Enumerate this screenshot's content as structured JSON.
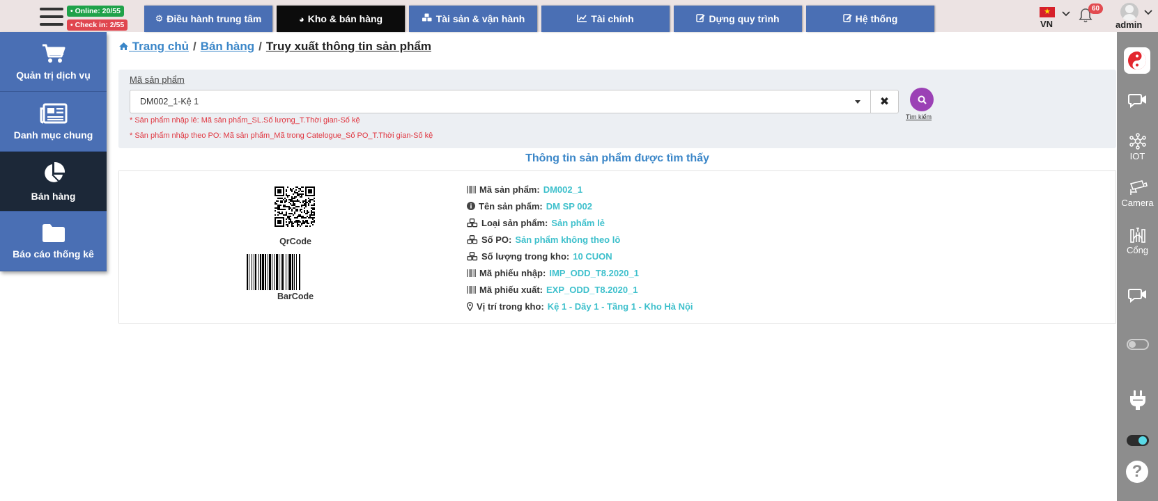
{
  "header": {
    "online_badge": "• Online: 20/55",
    "checkin_badge": "• Check in: 2/55",
    "tabs": [
      {
        "icon": "gear-icon",
        "label": "Điều hành trung tâm"
      },
      {
        "icon": "pie-chart-icon",
        "label": "Kho & bán hàng"
      },
      {
        "icon": "cubes-icon",
        "label": "Tài sản & vận hành"
      },
      {
        "icon": "line-chart-icon",
        "label": "Tài chính"
      },
      {
        "icon": "edit-icon",
        "label": "Dựng quy trình"
      },
      {
        "icon": "edit-icon",
        "label": "Hệ thống"
      }
    ],
    "active_tab": "Kho & bán hàng",
    "language": "VN",
    "notification_count": "60",
    "username": "admin"
  },
  "sidebar": {
    "items": [
      {
        "icon": "cart-icon",
        "label": "Quản trị dịch vụ"
      },
      {
        "icon": "newspaper-icon",
        "label": "Danh mục chung"
      },
      {
        "icon": "pie-chart-icon",
        "label": "Bán hàng"
      },
      {
        "icon": "folder-icon",
        "label": "Báo cáo thống kê"
      }
    ],
    "active_item": "Bán hàng"
  },
  "breadcrumb": {
    "home": "Trang chủ",
    "section": "Bán hàng",
    "current": "Truy xuất thông tin sản phẩm"
  },
  "search": {
    "label": "Mã sản phẩm",
    "value": "DM002_1-Kệ 1",
    "hint_1": "* Sản phẩm nhập lẻ: Mã sản phẩm_SL.Số lượng_T.Thời gian-Số kệ",
    "hint_2": "* Sản phẩm nhập theo PO: Mã sản phẩm_Mã trong Catelogue_Số PO_T.Thời gian-Số kệ",
    "button_label": "Tìm kiếm"
  },
  "result": {
    "title": "Thông tin sản phẩm được tìm thấy",
    "qr_label": "QrCode",
    "barcode_label": "BarCode",
    "fields": [
      {
        "icon": "barcode-icon",
        "label": "Mã sản phẩm:",
        "value": "DM002_1"
      },
      {
        "icon": "info-icon",
        "label": "Tên sản phẩm:",
        "value": "DM SP 002"
      },
      {
        "icon": "cubes-icon",
        "label": "Loại sản phẩm:",
        "value": "Sản phẩm lẻ"
      },
      {
        "icon": "cubes-icon",
        "label": "Số PO:",
        "value": "Sản phẩm không theo lô"
      },
      {
        "icon": "cubes-icon",
        "label": "Số lượng trong kho:",
        "value": "10 CUON"
      },
      {
        "icon": "barcode-icon",
        "label": "Mã phiếu nhập:",
        "value": "IMP_ODD_T8.2020_1"
      },
      {
        "icon": "barcode-icon",
        "label": "Mã phiếu xuất:",
        "value": "EXP_ODD_T8.2020_1"
      },
      {
        "icon": "map-marker-icon",
        "label": "Vị trí trong kho:",
        "value": "Kệ 1 - Dãy 1 - Tầng 1 - Kho Hà Nội"
      }
    ]
  },
  "right_rail": {
    "iot_label": "IOT",
    "camera_label": "Camera",
    "gate_label": "Cổng",
    "toggle_1_on": false,
    "toggle_2_on": true,
    "help_glyph": "?"
  },
  "colors": {
    "nav_blue": "#4a6fb4",
    "active_dark": "#0c0c0c",
    "sidebar_active": "#1c2838",
    "link_blue": "#3a86c8",
    "value_cyan": "#3ec0cc",
    "hint_red": "#e0353f",
    "search_purple": "#9b41b5",
    "online_green": "#1fa24a",
    "checkin_red": "#e0464f",
    "rail_gray": "#8d8d8d"
  }
}
